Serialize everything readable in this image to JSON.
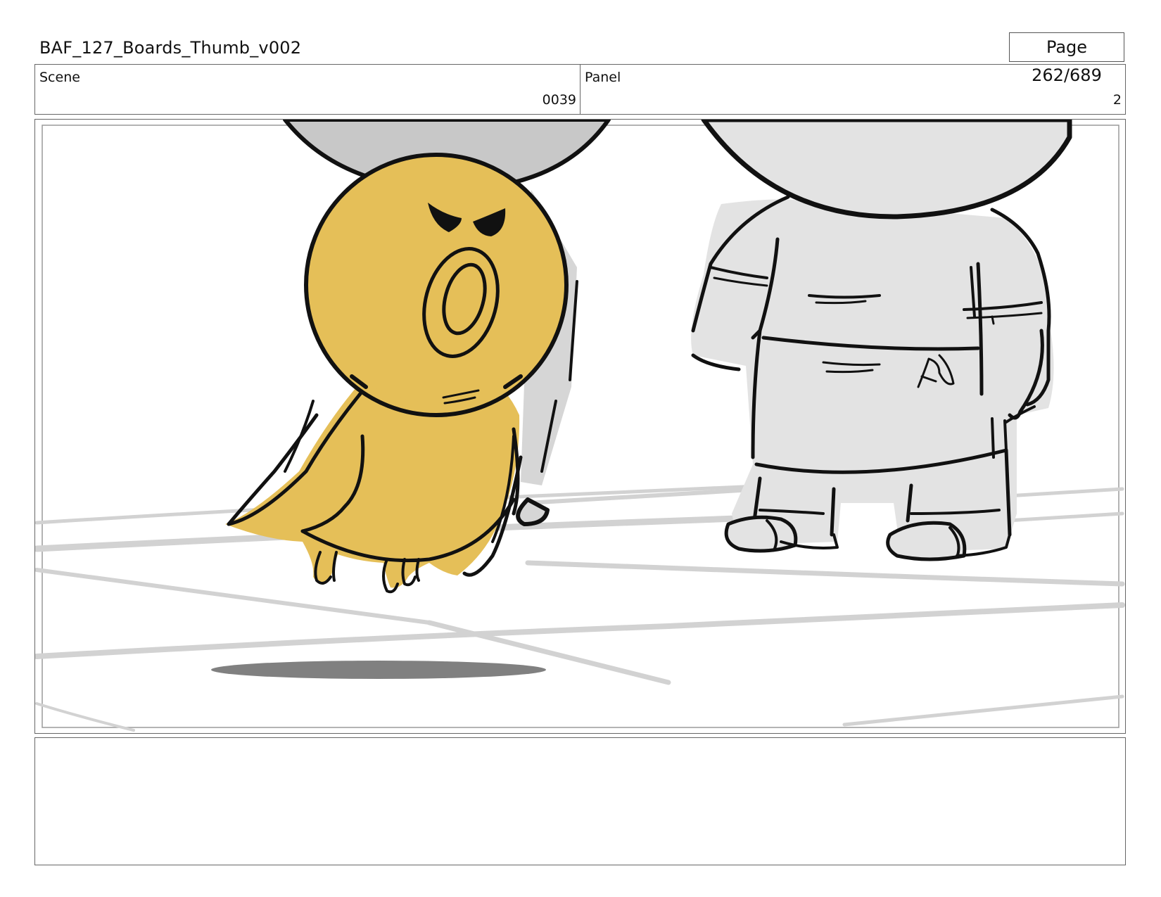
{
  "header": {
    "document_title": "BAF_127_Boards_Thumb_v002",
    "page_indicator": "Page 262/689"
  },
  "info": {
    "scene_label": "Scene",
    "scene_value": "0039",
    "panel_label": "Panel",
    "panel_value": "2"
  },
  "panel_image": {
    "content": "storyboard-sketch",
    "colors": {
      "bird_fill": "#E5BF58",
      "character_fill": "#E3E3E3",
      "head_fill": "#C8C8C8",
      "ink": "#111111",
      "shadow": "#808080",
      "floor_lines": "#D0D0D0"
    }
  },
  "notes": {
    "text": ""
  }
}
